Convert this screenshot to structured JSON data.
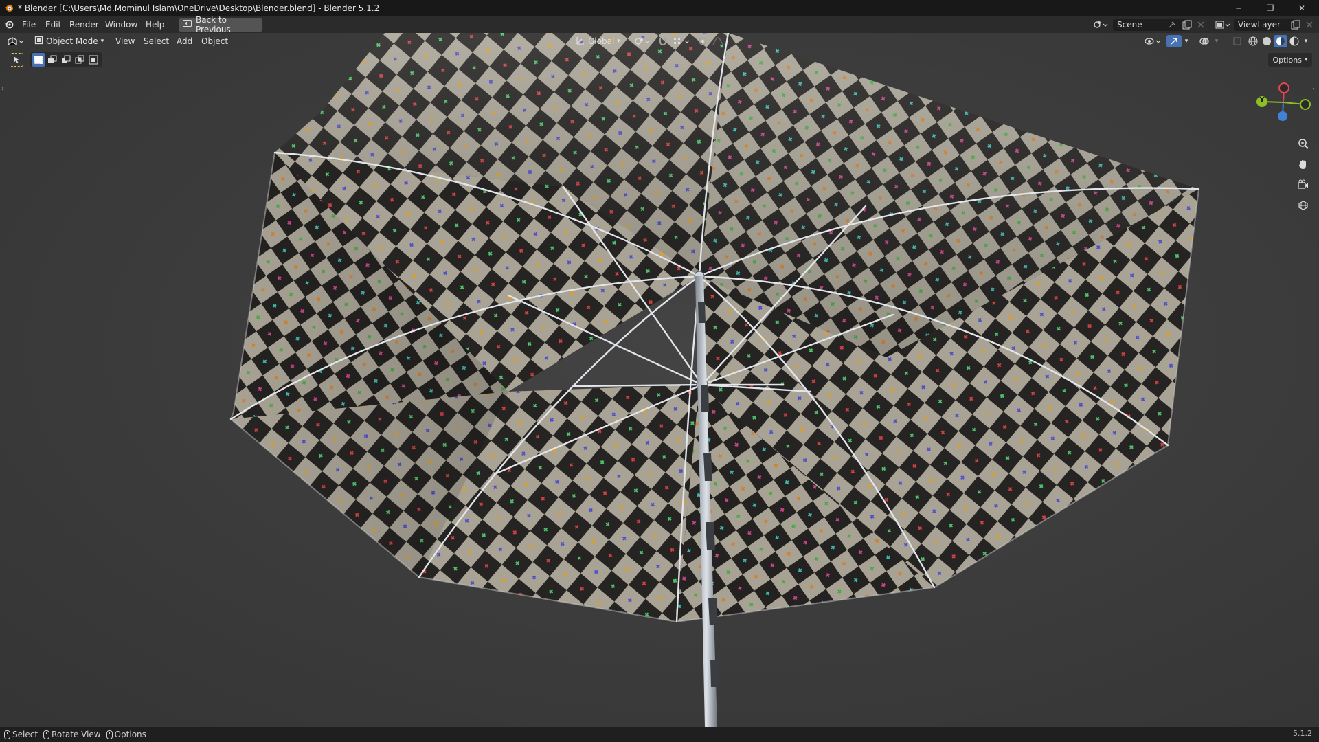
{
  "window": {
    "title": "* Blender [C:\\Users\\Md.Mominul Islam\\OneDrive\\Desktop\\Blender.blend] - Blender 5.1.2",
    "minimize_glyph": "─",
    "maximize_glyph": "❐",
    "close_glyph": "✕"
  },
  "topbar": {
    "menus": [
      "File",
      "Edit",
      "Render",
      "Window",
      "Help"
    ],
    "back_button": "Back to Previous",
    "scene_label": "Scene",
    "viewlayer_label": "ViewLayer"
  },
  "viewport_header": {
    "mode": "Object Mode",
    "menus": [
      "View",
      "Select",
      "Add",
      "Object"
    ],
    "transform_orientation": "Global",
    "options_label": "Options"
  },
  "statusbar": {
    "items": [
      "Select",
      "Rotate View",
      "Options"
    ],
    "version": "5.1.2"
  },
  "gizmo": {
    "y_label": "Y",
    "colors": {
      "x": "#e8434f",
      "y": "#8cbf26",
      "z": "#3f82d6"
    }
  },
  "colors": {
    "accent_blue": "#4772b3",
    "viewport_bg": "#3b3b3b",
    "checker_light": "#a9a396",
    "checker_dark": "#262422"
  },
  "icons": {
    "app": "blender-logo-icon",
    "zoom": "zoom-icon",
    "pan": "hand-pan-icon",
    "camera": "camera-view-icon",
    "ortho": "grid-ortho-icon"
  }
}
